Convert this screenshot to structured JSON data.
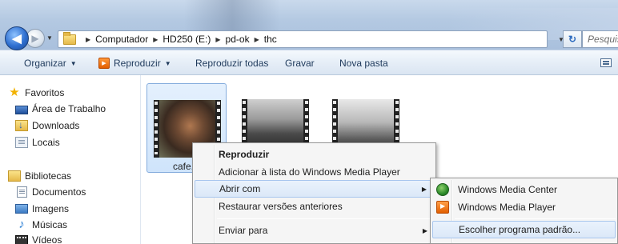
{
  "window": {
    "breadcrumbs": [
      "Computador",
      "HD250 (E:)",
      "pd-ok",
      "thc"
    ],
    "search_placeholder": "Pesquisar"
  },
  "toolbar": {
    "organize_label": "Organizar",
    "play_label": "Reproduzir",
    "play_all_label": "Reproduzir todas",
    "burn_label": "Gravar",
    "new_folder_label": "Nova pasta"
  },
  "sidebar": {
    "favorites": {
      "label": "Favoritos",
      "items": [
        {
          "label": "Área de Trabalho",
          "icon": "desktop-icon"
        },
        {
          "label": "Downloads",
          "icon": "downloads-folder-icon"
        },
        {
          "label": "Locais",
          "icon": "recent-places-icon"
        }
      ]
    },
    "libraries": {
      "label": "Bibliotecas",
      "items": [
        {
          "label": "Documentos",
          "icon": "documents-icon"
        },
        {
          "label": "Imagens",
          "icon": "pictures-icon"
        },
        {
          "label": "Músicas",
          "icon": "music-icon"
        },
        {
          "label": "Vídeos",
          "icon": "videos-icon"
        }
      ]
    }
  },
  "files": [
    {
      "name": "cafe.m",
      "selected": true
    },
    {
      "name": "",
      "selected": false
    },
    {
      "name": "",
      "selected": false
    }
  ],
  "context_menu": {
    "items": [
      {
        "label": "Reproduzir",
        "bold": true
      },
      {
        "label": "Adicionar à lista do Windows Media Player"
      },
      {
        "label": "Abrir com",
        "has_submenu": true,
        "highlighted": true
      },
      {
        "label": "Restaurar versões anteriores"
      },
      {
        "label": "Enviar para",
        "has_submenu": true
      }
    ]
  },
  "submenu": {
    "items": [
      {
        "label": "Windows Media Center",
        "icon": "windows-media-center-icon"
      },
      {
        "label": "Windows Media Player",
        "icon": "windows-media-player-icon"
      },
      {
        "label": "Escolher programa padrão...",
        "highlighted": true
      }
    ]
  }
}
